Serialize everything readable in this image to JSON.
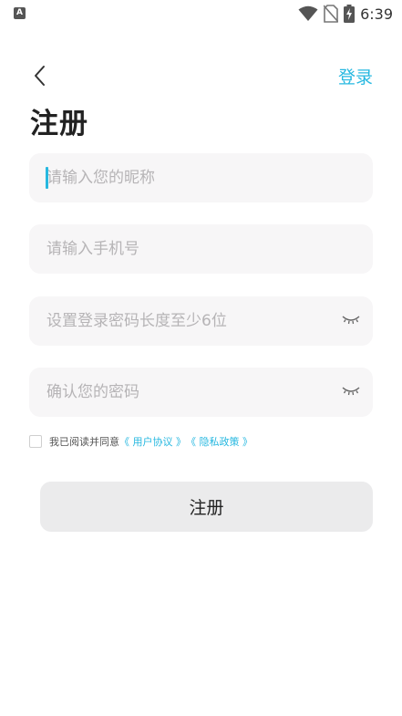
{
  "status_bar": {
    "notification_letter": "A",
    "time": "6:39",
    "icons": [
      "wifi-icon",
      "no-sim-icon",
      "battery-charging-icon"
    ]
  },
  "nav": {
    "back_icon": "chevron-left-icon",
    "login_label": "登录"
  },
  "title": "注册",
  "form": {
    "nickname_placeholder": "请输入您的昵称",
    "phone_placeholder": "请输入手机号",
    "password_placeholder": "设置登录密码长度至少6位",
    "confirm_placeholder": "确认您的密码",
    "eye_icon": "eye-closed-icon"
  },
  "agreement": {
    "prefix": "我已阅读并同意",
    "user_agreement": "《 用户协议 》",
    "privacy_policy": "《 隐私政策 》"
  },
  "submit_label": "注册",
  "colors": {
    "accent": "#27b8e0",
    "field_bg": "#f7f6f7",
    "button_bg": "#ebebec"
  }
}
